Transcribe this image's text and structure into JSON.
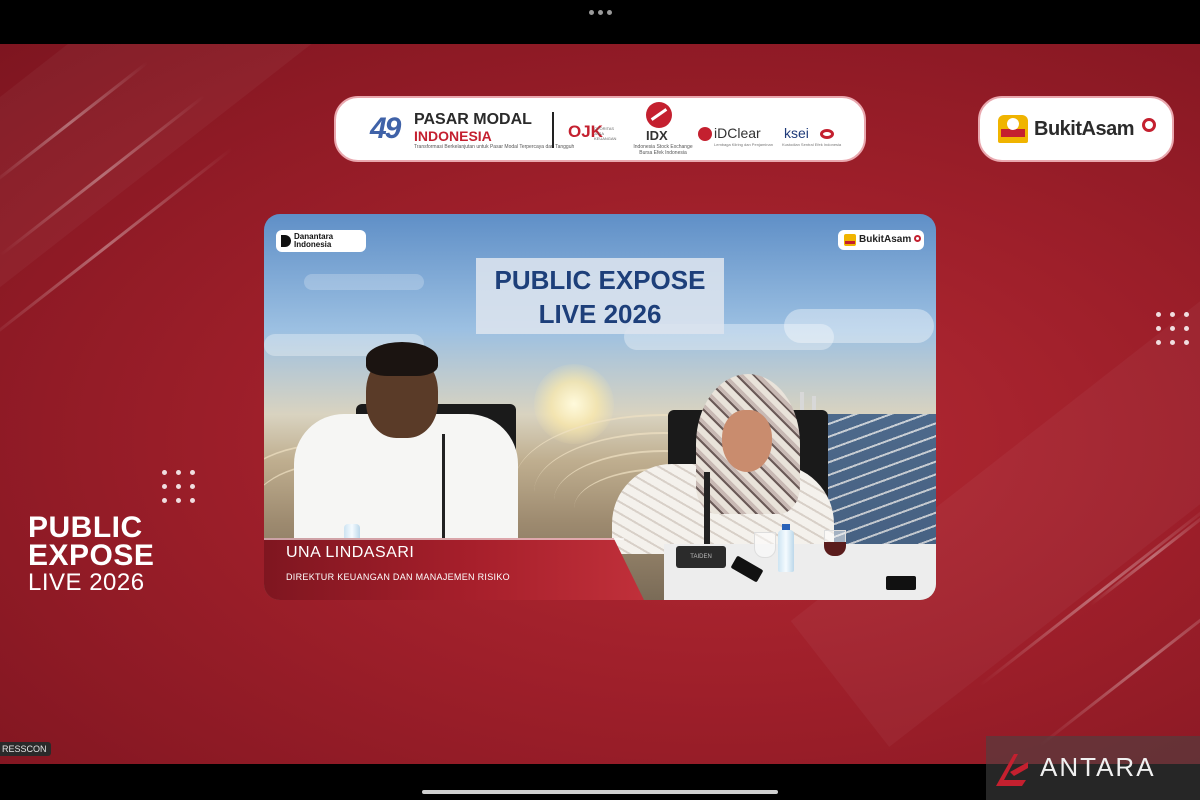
{
  "sponsors": {
    "pasar_modal_mark": "49",
    "pasar_modal_title": "PASAR MODAL",
    "pasar_modal_subtitle": "INDONESIA",
    "pasar_modal_tagline": "Transformasi Berkelanjutan untuk Pasar Modal Terpercaya dan Tangguh",
    "ojk_label": "OJK",
    "ojk_subtitle": "OTORITAS JASA KEUANGAN",
    "idx_label": "IDX",
    "idx_subtitle": "Indonesia Stock Exchange Bursa Efek Indonesia",
    "idclear_label": "iDClear",
    "idclear_subtitle": "Lembaga Kliring dan Penjaminan",
    "ksei_label": "ksei",
    "ksei_subtitle": "Kustodian Sentral Efek Indonesia"
  },
  "brand": {
    "name": "BukitAsam"
  },
  "video": {
    "title_line1": "PUBLIC EXPOSE",
    "title_line2": "LIVE 2026",
    "logo_left": "Danantara Indonesia",
    "logo_right": "BukitAsam",
    "device_label": "TAIDEN",
    "speaker_name": "UNA LINDASARI",
    "speaker_role": "DIREKTUR KEUANGAN DAN MANAJEMEN RISIKO"
  },
  "event_logo": {
    "line1": "PUBLIC",
    "line2": "EXPOSE",
    "line3": "LIVE 2026"
  },
  "source_label": "RESSCON",
  "watermark": "ANTARA",
  "colors": {
    "background_red": "#9e1f2a",
    "accent_red": "#c4202f",
    "title_blue": "#1d3f7a",
    "brand_yellow": "#f0b400"
  }
}
